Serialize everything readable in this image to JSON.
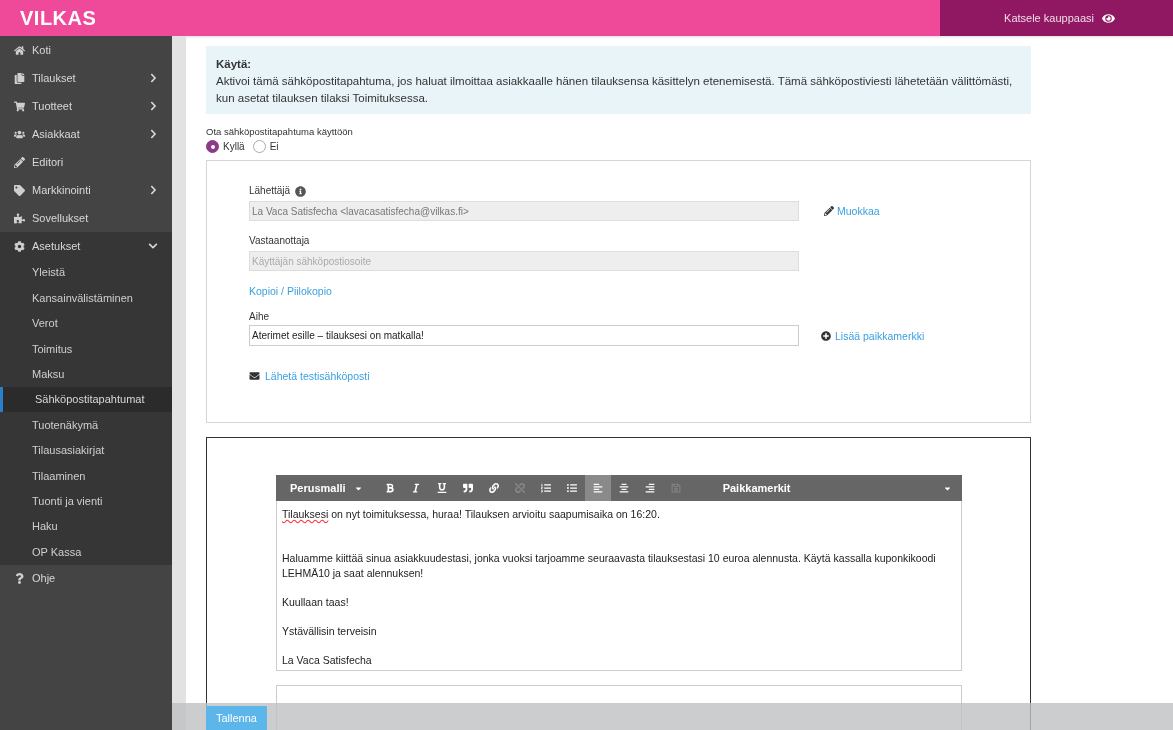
{
  "header": {
    "logo": "VILKAS",
    "view_store": "Katsele kauppaasi"
  },
  "sidebar": {
    "items": [
      {
        "label": "Koti",
        "expandable": false,
        "expanded": false
      },
      {
        "label": "Tilaukset",
        "expandable": true,
        "expanded": false
      },
      {
        "label": "Tuotteet",
        "expandable": true,
        "expanded": false
      },
      {
        "label": "Asiakkaat",
        "expandable": true,
        "expanded": false
      },
      {
        "label": "Editori",
        "expandable": false,
        "expanded": false
      },
      {
        "label": "Markkinointi",
        "expandable": true,
        "expanded": false
      },
      {
        "label": "Sovellukset",
        "expandable": false,
        "expanded": false
      },
      {
        "label": "Asetukset",
        "expandable": true,
        "expanded": true,
        "children": [
          {
            "label": "Yleistä",
            "selected": false
          },
          {
            "label": "Kansainvälistäminen",
            "selected": false
          },
          {
            "label": "Verot",
            "selected": false
          },
          {
            "label": "Toimitus",
            "selected": false
          },
          {
            "label": "Maksu",
            "selected": false
          },
          {
            "label": "Sähköpostitapahtumat",
            "selected": true
          },
          {
            "label": "Tuotenäkymä",
            "selected": false
          },
          {
            "label": "Tilausasiakirjat",
            "selected": false
          },
          {
            "label": "Tilaaminen",
            "selected": false
          },
          {
            "label": "Tuonti ja vienti",
            "selected": false
          },
          {
            "label": "Haku",
            "selected": false
          },
          {
            "label": "OP Kassa",
            "selected": false
          }
        ]
      },
      {
        "label": "Ohje",
        "expandable": false,
        "expanded": false
      }
    ]
  },
  "info": {
    "title": "Käytä:",
    "text": "Aktivoi tämä sähköpostitapahtuma, jos haluat ilmoittaa asiakkaalle hänen tilauksensa käsittelyn etenemisestä. Tämä sähköpostiviesti lähetetään välittömästi, kun asetat tilauksen tilaksi Toimituksessa."
  },
  "enable": {
    "label": "Ota sähköpostitapahtuma käyttöön",
    "options": [
      {
        "label": "Kyllä",
        "selected": true
      },
      {
        "label": "Ei",
        "selected": false
      }
    ]
  },
  "form": {
    "sender": {
      "label": "Lähettäjä",
      "value": "La Vaca Satisfecha <lavacasatisfecha@vilkas.fi>",
      "disabled": true,
      "action": "Muokkaa"
    },
    "recipient": {
      "label": "Vastaanottaja",
      "placeholder": "Käyttäjän sähköpostiosoite",
      "disabled": true
    },
    "cc_link": "Kopioi / Piilokopio",
    "subject": {
      "label": "Aihe",
      "value": "Aterimet esille – tilauksesi on matkalla!",
      "action": "Lisää paikkamerkki"
    },
    "test_link": "Lähetä testisähköposti"
  },
  "editor": {
    "toolbar": [
      {
        "kind": "dropdown",
        "label": "Perusmalli",
        "active": false,
        "disabled": false
      },
      {
        "kind": "bold",
        "active": false,
        "disabled": false
      },
      {
        "kind": "italic",
        "active": false,
        "disabled": false
      },
      {
        "kind": "underline",
        "active": false,
        "disabled": false
      },
      {
        "kind": "quote",
        "active": false,
        "disabled": false
      },
      {
        "kind": "link",
        "active": false,
        "disabled": false
      },
      {
        "kind": "unlink",
        "active": false,
        "disabled": true
      },
      {
        "kind": "ordered-list",
        "active": false,
        "disabled": false
      },
      {
        "kind": "bullet-list",
        "active": false,
        "disabled": false
      },
      {
        "kind": "align-left",
        "active": true,
        "disabled": false
      },
      {
        "kind": "align-center",
        "active": false,
        "disabled": false
      },
      {
        "kind": "align-right",
        "active": false,
        "disabled": false
      },
      {
        "kind": "source",
        "active": false,
        "disabled": true
      },
      {
        "kind": "wide-dropdown",
        "label": "Paikkamerkit",
        "active": false,
        "disabled": false
      }
    ],
    "paragraphs": [
      {
        "text": "Tilauksesi on nyt toimituksessa, huraa! Tilauksen arvioitu saapumisaika on 16:20.",
        "flagged_first_word": true
      },
      {
        "text": "Haluamme kiittää sinua asiakkuudestasi, jonka vuoksi tarjoamme seuraavasta tilauksestasi 10 euroa alennusta. Käytä kassalla kuponkikoodi LEHMÄ10 ja saat alennuksen!",
        "flagged_first_word": false
      },
      {
        "text": "Kuullaan taas!",
        "flagged_first_word": false
      },
      {
        "text": "Ystävällisin terveisin",
        "flagged_first_word": false
      },
      {
        "text": "La Vaca Satisfecha",
        "flagged_first_word": false
      }
    ]
  },
  "footer": {
    "save": "Tallenna"
  }
}
